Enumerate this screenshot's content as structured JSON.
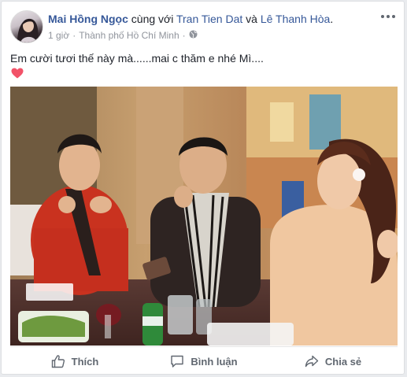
{
  "post": {
    "author": "Mai Hồng Ngọc",
    "with_text": " cùng với ",
    "tag1": "Tran Tien Dat",
    "and_text": " và ",
    "tag2": "Lê Thanh Hòa",
    "period": ".",
    "time": "1 giờ",
    "separator": "·",
    "location": "Thành phố Hồ Chí Minh",
    "separator2": "·",
    "audience_icon": "globe-icon",
    "text": "Em cười tươi thế này mà......mai c thăm e nhé Mì....",
    "emoji": "heart-icon"
  },
  "actions": {
    "like": "Thích",
    "comment": "Bình luận",
    "share": "Chia sẻ"
  },
  "colors": {
    "link": "#365899",
    "heart": "#f25268"
  }
}
